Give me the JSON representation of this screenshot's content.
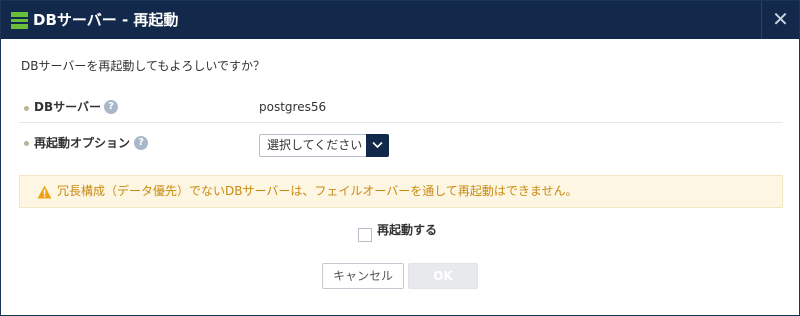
{
  "dialog": {
    "title": "DBサーバー - 再起動",
    "close_label": "✕"
  },
  "question": "DBサーバーを再起動してもよろしいですか？",
  "fields": {
    "db_server": {
      "label": "DBサーバー",
      "value": "postgres56",
      "help": "?"
    },
    "restart_option": {
      "label": "再起動オプション",
      "selected": "選択してください",
      "help": "?"
    }
  },
  "warning": {
    "text": "冗長構成（データ優先）でないDBサーバーは、フェイルオーバーを通して再起動はできません。",
    "color": "#c98a12"
  },
  "confirm": {
    "label": "再起動する",
    "checked": false
  },
  "buttons": {
    "cancel": "キャンセル",
    "ok": "OK"
  },
  "colors": {
    "titlebar": "#13294b",
    "icon_accent": "#6abf3a"
  }
}
